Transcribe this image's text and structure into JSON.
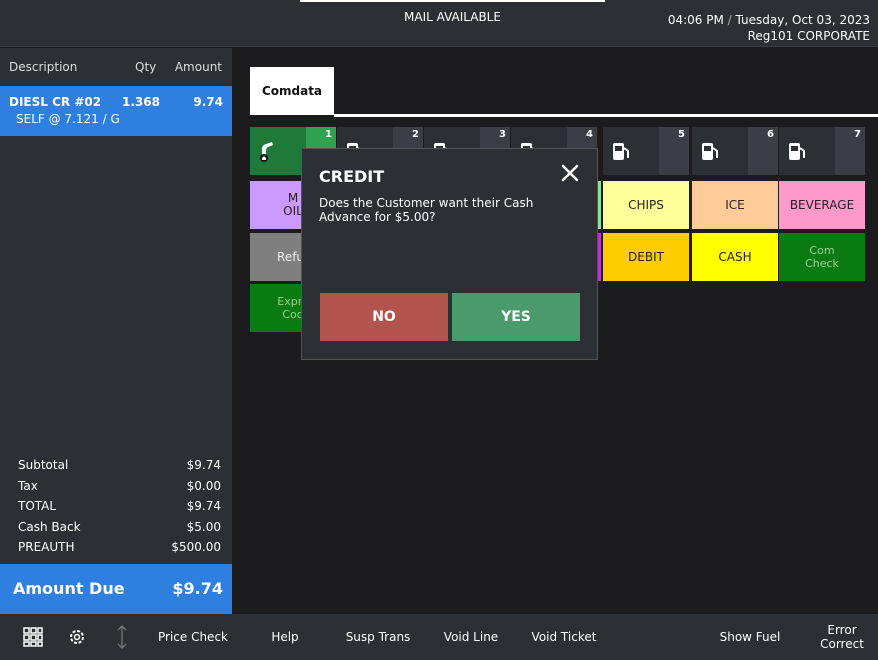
{
  "topbar": {
    "mail": "MAIL AVAILABLE",
    "time": "04:06 PM",
    "separator": "/",
    "date": "Tuesday, Oct 03, 2023",
    "register": "Reg101",
    "site": "CORPORATE"
  },
  "transaction": {
    "headers": {
      "description": "Description",
      "qty": "Qty",
      "amount": "Amount"
    },
    "item": {
      "description": "DIESL CR #02",
      "qty": "1.368",
      "amount": "9.74",
      "detail": "SELF @ 7.121 / G"
    },
    "totals": [
      {
        "label": "Subtotal",
        "value": "$9.74"
      },
      {
        "label": "Tax",
        "value": "$0.00"
      },
      {
        "label": "TOTAL",
        "value": "$9.74"
      },
      {
        "label": "Cash Back",
        "value": "$5.00"
      },
      {
        "label": "PREAUTH",
        "value": "$500.00"
      }
    ],
    "amount_due": {
      "label": "Amount Due",
      "value": "$9.74"
    }
  },
  "tab": {
    "label": "Comdata"
  },
  "pumps": [
    "1",
    "2",
    "3",
    "4",
    "5",
    "6",
    "7"
  ],
  "buttons": {
    "motor_oil": "M\nOIL",
    "refund": "Refur",
    "express_code": "Expre\nCod",
    "chips": "CHIPS",
    "ice": "ICE",
    "beverage": "BEVERAGE",
    "debit": "DEBIT",
    "cash": "CASH",
    "comcheck": "Com\nCheck"
  },
  "modal": {
    "title": "CREDIT",
    "message": "Does the Customer want their Cash Advance for $5.00?",
    "no": "NO",
    "yes": "YES"
  },
  "toolbar": {
    "price_check": "Price Check",
    "help": "Help",
    "susp_trans": "Susp Trans",
    "void_line": "Void Line",
    "void_ticket": "Void Ticket",
    "show_fuel": "Show Fuel",
    "error_correct": "Error\nCorrect"
  },
  "colors": {
    "accent_blue": "#2f7fe0",
    "pump_active": "#1f7a3a",
    "no_button": "#b3534d",
    "yes_button": "#4a9a6c"
  }
}
